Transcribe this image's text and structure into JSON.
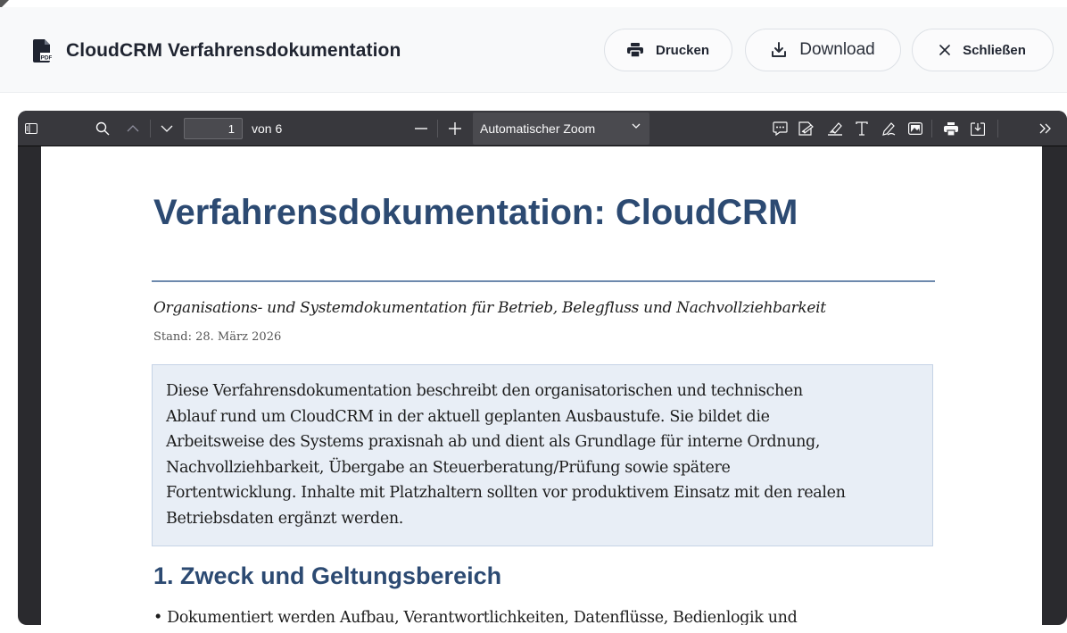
{
  "header": {
    "title": "CloudCRM Verfahrensdokumentation",
    "file_icon": "pdf-file-icon",
    "buttons": {
      "print": "Drucken",
      "download": "Download",
      "close": "Schließen"
    }
  },
  "toolbar": {
    "page_current": "1",
    "page_of": "von 6",
    "zoom": "Automatischer Zoom",
    "icons_left": [
      "sidebar-toggle-icon",
      "search-icon",
      "chevron-up-icon",
      "chevron-down-icon"
    ],
    "icons_zoom": [
      "zoom-out-icon",
      "zoom-in-icon"
    ],
    "icons_right": [
      "comment-icon",
      "signature-icon",
      "highlight-icon",
      "text-icon",
      "draw-icon",
      "image-icon",
      "print-icon",
      "save-icon",
      "more-tools-icon"
    ]
  },
  "document": {
    "title": "Verfahrensdokumentation: CloudCRM",
    "subtitle": "Organisations- und Systemdokumentation für Betrieb, Belegfluss und Nachvollziehbarkeit",
    "stand": "Stand: 28. März 2026",
    "intro_lines": [
      "Diese Verfahrensdokumentation beschreibt den organisatorischen und technischen",
      "Ablauf rund um CloudCRM in der aktuell geplanten Ausbaustufe. Sie bildet die",
      "Arbeitsweise des Systems praxisnah ab und dient als Grundlage für interne Ordnung,",
      "Nachvollziehbarkeit, Übergabe an Steuerberatung/Prüfung sowie spätere",
      "Fortentwicklung. Inhalte mit Platzhaltern sollten vor produktivem Einsatz mit den realen",
      "Betriebsdaten ergänzt werden."
    ],
    "section1_heading": "1. Zweck und Geltungsbereich",
    "section1_bullet": "• Dokumentiert werden Aufbau, Verantwortlichkeiten, Datenflüsse, Bedienlogik und"
  },
  "colors": {
    "accent": "#2c4a72",
    "viewer_bg": "#2a2a2e",
    "toolbar_bg": "#38383d",
    "box_bg": "#e8eef6"
  }
}
